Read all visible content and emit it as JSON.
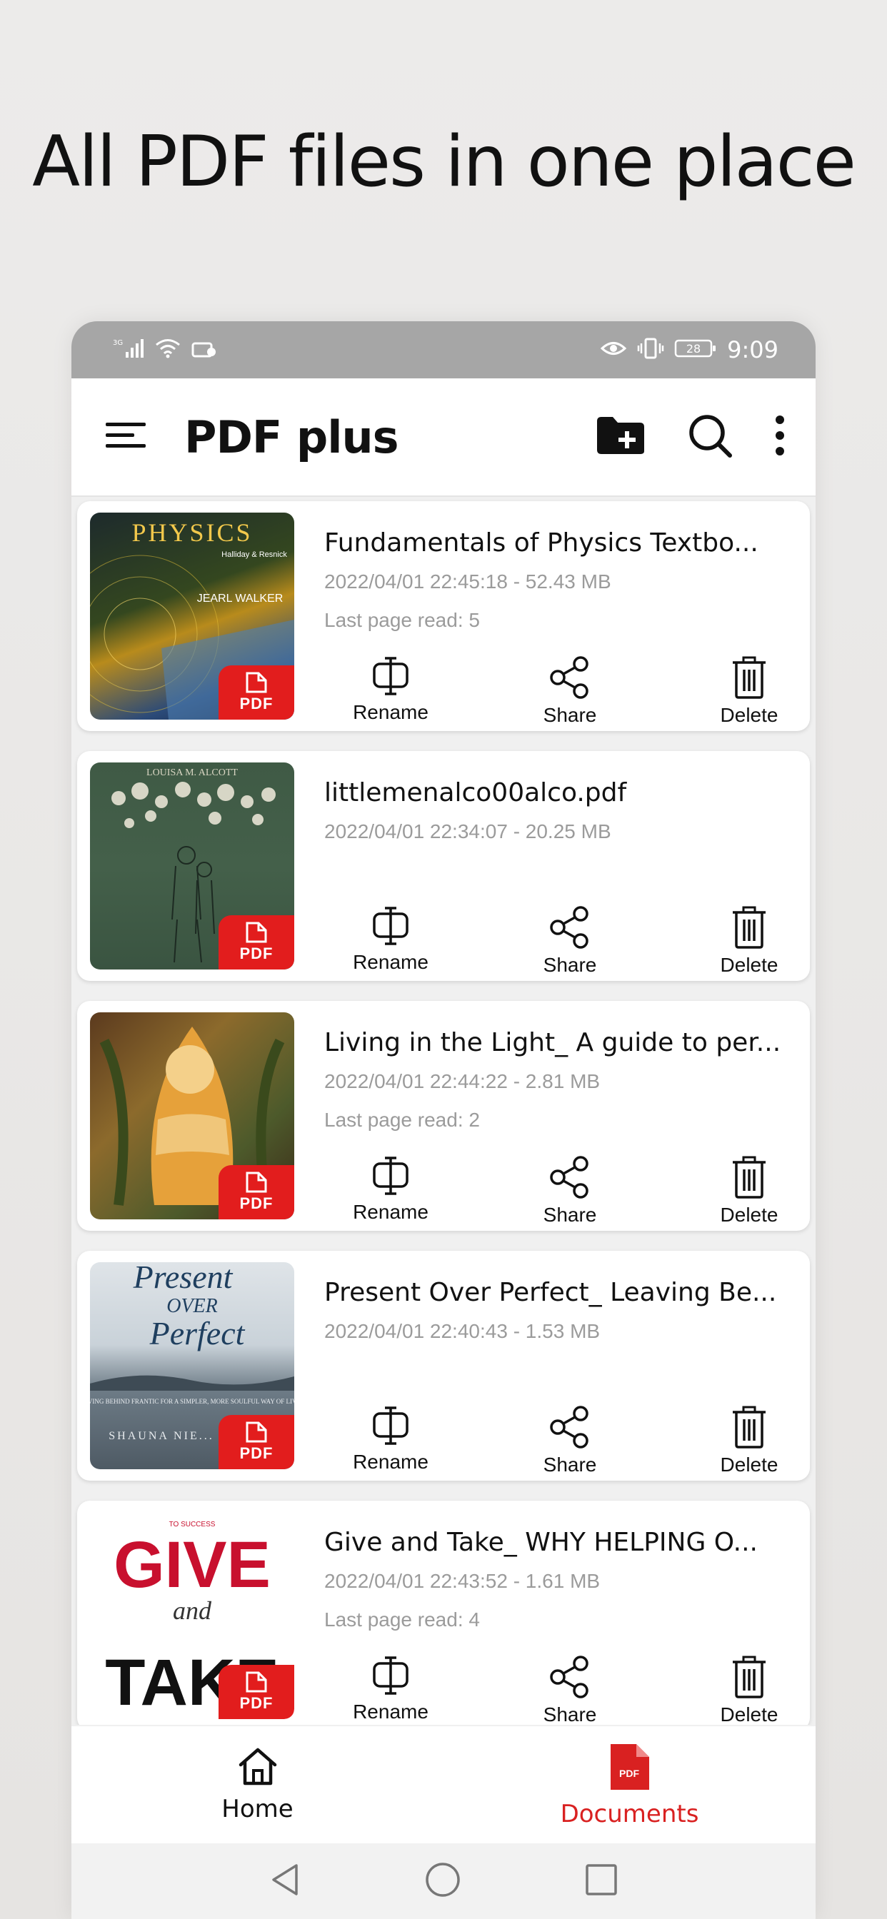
{
  "headline": "All PDF files in one place",
  "status_bar": {
    "time": "9:09",
    "battery": "28",
    "network": "3G"
  },
  "app_bar": {
    "title": "PDF plus"
  },
  "files": [
    {
      "name": "Fundamentals of Physics Textbo...",
      "meta": "2022/04/01 22:45:18 - 52.43 MB",
      "last_read": "Last page read: 5",
      "cover": {
        "title": "PHYSICS",
        "subtitle": "Halliday & Resnick",
        "author": "JEARL WALKER"
      }
    },
    {
      "name": "littlemenalco00alco.pdf",
      "meta": "2022/04/01 22:34:07 - 20.25 MB",
      "last_read": "",
      "cover": {
        "title": "LOUISA M. ALCOTT"
      }
    },
    {
      "name": "Living in the Light_ A guide to per...",
      "meta": "2022/04/01 22:44:22 - 2.81 MB",
      "last_read": "Last page read: 2",
      "cover": {}
    },
    {
      "name": "Present Over Perfect_ Leaving Be...",
      "meta": "2022/04/01 22:40:43 - 1.53 MB",
      "last_read": "",
      "cover": {
        "title": "Present",
        "mid": "OVER",
        "end": "Perfect",
        "tagline": "LEAVING BEHIND FRANTIC FOR A SIMPLER, MORE SOULFUL WAY OF LIVING",
        "author": "SHAUNA NIE..."
      }
    },
    {
      "name": "Give and Take_ WHY HELPING O...",
      "meta": "2022/04/01 22:43:52 - 1.61 MB",
      "last_read": "Last page read: 4",
      "cover": {
        "top": "TO SUCCESS",
        "line1": "GIVE",
        "line2": "and",
        "line3": "TAKE"
      }
    }
  ],
  "actions": {
    "rename": "Rename",
    "share": "Share",
    "delete": "Delete"
  },
  "pdf_badge": "PDF",
  "bottom_nav": {
    "home": "Home",
    "documents": "Documents"
  },
  "colors": {
    "accent": "#d92121",
    "badge": "#e21d1d",
    "meta_text": "#9b9b9b",
    "status_bar": "#a6a6a6"
  }
}
